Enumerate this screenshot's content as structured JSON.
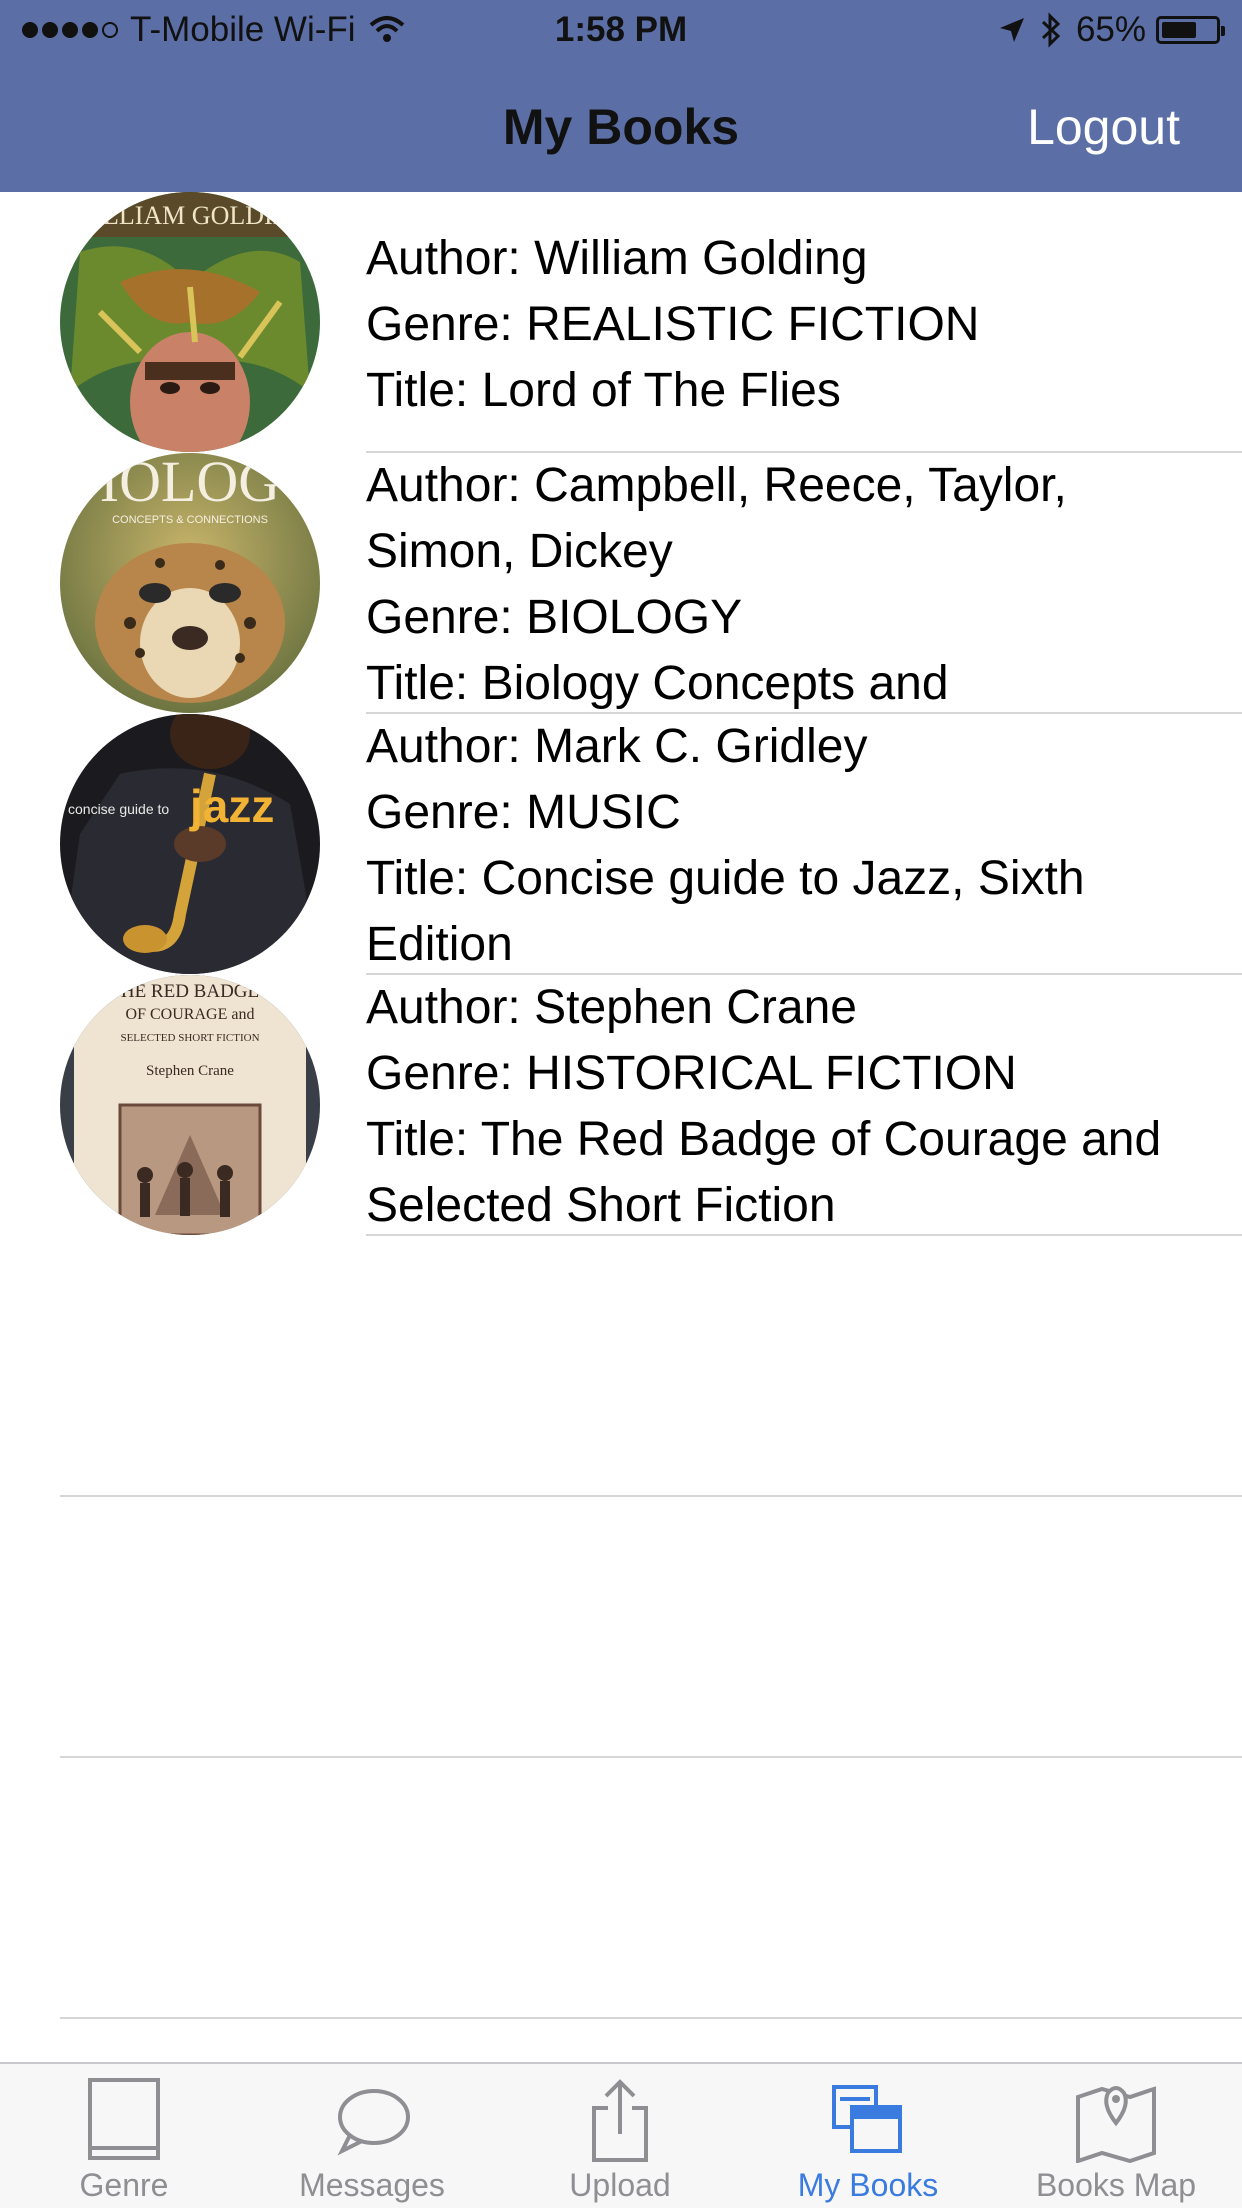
{
  "status_bar": {
    "carrier": "T-Mobile Wi-Fi",
    "time": "1:58 PM",
    "battery": "65%",
    "battery_level": 0.65
  },
  "nav": {
    "title": "My Books",
    "logout_label": "Logout"
  },
  "books": [
    {
      "cover_icon": "lord-of-the-flies-cover",
      "author": "Author: William Golding",
      "genre": "Genre: REALISTIC FICTION",
      "title": "Title: Lord of The Flies"
    },
    {
      "cover_icon": "biology-cover",
      "author": "Author: Campbell, Reece, Taylor, Simon, Dickey",
      "genre": "Genre: BIOLOGY",
      "title": "Title: Biology Concepts and"
    },
    {
      "cover_icon": "jazz-cover",
      "author": "Author: Mark C. Gridley",
      "genre": "Genre: MUSIC",
      "title": "Title: Concise guide to Jazz, Sixth Edition"
    },
    {
      "cover_icon": "red-badge-cover",
      "author": "Author: Stephen Crane",
      "genre": "Genre: HISTORICAL FICTION",
      "title": "Title: The Red Badge of Courage and Selected Short Fiction"
    }
  ],
  "cover_text": {
    "book1": "WILLIAM GOLDING",
    "book2": "IOLOG",
    "book2_sub": "CONCEPTS & CONNECTIONS",
    "book3_small": "concise guide to",
    "book3_big": "jazz",
    "book4_line1": "HE RED BADGE",
    "book4_line2": "OF COURAGE and",
    "book4_line3": "SELECTED SHORT FICTION",
    "book4_author": "Stephen Crane"
  },
  "tabs": [
    {
      "label": "Genre",
      "icon": "book-icon",
      "active": false
    },
    {
      "label": "Messages",
      "icon": "speech-bubble-icon",
      "active": false
    },
    {
      "label": "Upload",
      "icon": "share-upload-icon",
      "active": false
    },
    {
      "label": "My Books",
      "icon": "books-stack-icon",
      "active": true
    },
    {
      "label": "Books Map",
      "icon": "map-pin-icon",
      "active": false
    }
  ],
  "colors": {
    "nav_bg": "#5b6fa6",
    "tab_active": "#3a7be0",
    "tab_inactive": "#8e8e93",
    "separator": "#d6d6d9"
  }
}
